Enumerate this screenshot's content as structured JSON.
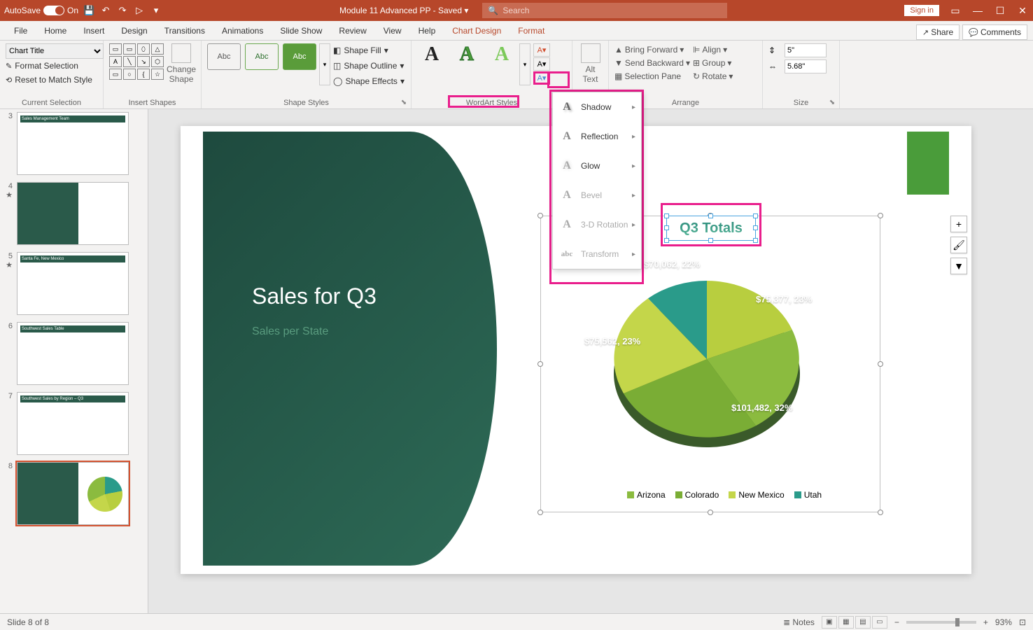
{
  "titlebar": {
    "autosave": "AutoSave",
    "autosave_state": "On",
    "doc": "Module 11 Advanced PP  -  Saved ▾",
    "search_placeholder": "Search",
    "signin": "Sign in"
  },
  "tabs": {
    "file": "File",
    "home": "Home",
    "insert": "Insert",
    "design": "Design",
    "transitions": "Transitions",
    "animations": "Animations",
    "slideshow": "Slide Show",
    "review": "Review",
    "view": "View",
    "help": "Help",
    "chartdesign": "Chart Design",
    "format": "Format",
    "share": "Share",
    "comments": "Comments"
  },
  "ribbon": {
    "cur_sel": {
      "dropdown": "Chart Title",
      "format_sel": "Format Selection",
      "reset": "Reset to Match Style",
      "label": "Current Selection"
    },
    "insert_shapes": {
      "change": "Change\nShape",
      "label": "Insert Shapes"
    },
    "shape_styles": {
      "abc": "Abc",
      "fill": "Shape Fill",
      "outline": "Shape Outline",
      "effects": "Shape Effects",
      "label": "Shape Styles"
    },
    "wordart": {
      "label": "WordArt Styles"
    },
    "alttext": {
      "label": "Alt\nText"
    },
    "arrange": {
      "forward": "Bring Forward",
      "backward": "Send Backward",
      "selection": "Selection Pane",
      "align": "Align",
      "group": "Group",
      "rotate": "Rotate",
      "label": "Arrange"
    },
    "size": {
      "h": "5\"",
      "w": "5.68\"",
      "label": "Size"
    }
  },
  "menu": {
    "shadow": "Shadow",
    "reflection": "Reflection",
    "glow": "Glow",
    "bevel": "Bevel",
    "rotation": "3-D Rotation",
    "transform": "Transform"
  },
  "slides": {
    "count": 8,
    "current": 8,
    "labels": [
      "",
      "",
      "Sales Management Team",
      "",
      "Santa Fe, New Mexico",
      "Southwest Sales Table",
      "Southwest Sales by Region – Q3",
      "Sales for Q3"
    ]
  },
  "slide": {
    "title": "Sales for Q3",
    "subtitle": "Sales per State"
  },
  "chart_data": {
    "type": "pie",
    "title": "Q3 Totals",
    "series": [
      {
        "name": "Arizona",
        "value": 101482,
        "pct": 32,
        "color": "#8bbb3f",
        "label": "$101,482, 32%"
      },
      {
        "name": "Colorado",
        "value": 75562,
        "pct": 23,
        "color": "#c4d64a",
        "label": "$75,562, 23%"
      },
      {
        "name": "New Mexico",
        "value": 75377,
        "pct": 23,
        "color": "#b8ce3f",
        "label": "$75,377, 23%"
      },
      {
        "name": "Utah",
        "value": 70062,
        "pct": 22,
        "color": "#2a9b8a",
        "label": "$70,062, 22%"
      }
    ],
    "legend": [
      "Arizona",
      "Colorado",
      "New Mexico",
      "Utah"
    ]
  },
  "status": {
    "slide": "Slide 8 of 8",
    "notes": "Notes",
    "zoom": "93%"
  }
}
